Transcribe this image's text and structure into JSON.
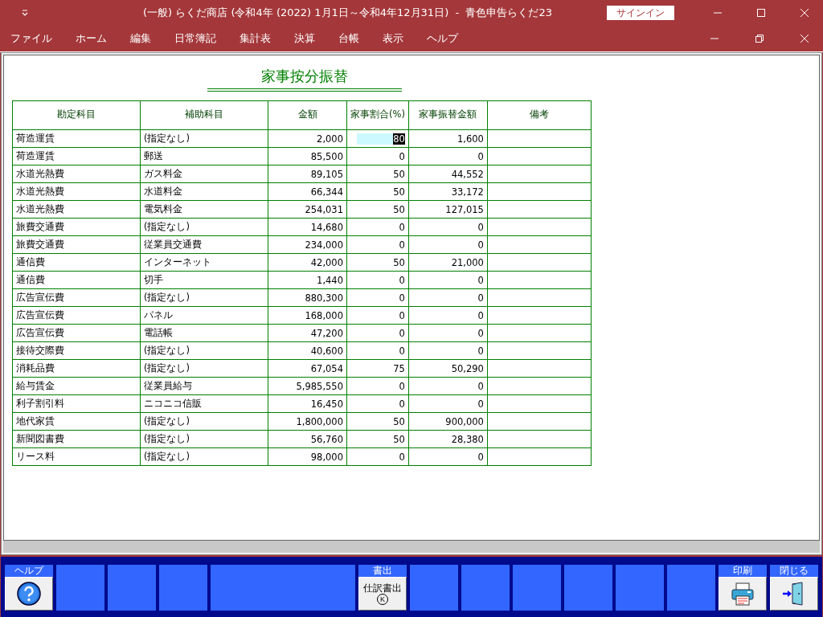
{
  "window": {
    "title": "(一般) らくだ商店 (令和4年 (2022) 1月1日～令和4年12月31日)  -  青色申告らくだ23",
    "sign_in": "サインイン"
  },
  "menu": [
    "ファイル",
    "ホーム",
    "編集",
    "日常簿記",
    "集計表",
    "決算",
    "台帳",
    "表示",
    "ヘルプ"
  ],
  "report": {
    "title": "家事按分振替",
    "columns": [
      "勘定科目",
      "補助科目",
      "金額",
      "家事割合(%)",
      "家事振替金額",
      "備考"
    ],
    "rows": [
      {
        "account": "荷造運賃",
        "sub_account": "(指定なし)",
        "amount": "2,000",
        "ratio": "80",
        "transfer": "1,600",
        "selected": true
      },
      {
        "account": "荷造運賃",
        "sub_account": "郵送",
        "amount": "85,500",
        "ratio": "0",
        "transfer": "0",
        "selected": false
      },
      {
        "account": "水道光熱費",
        "sub_account": "ガス料金",
        "amount": "89,105",
        "ratio": "50",
        "transfer": "44,552",
        "selected": false
      },
      {
        "account": "水道光熱費",
        "sub_account": "水道料金",
        "amount": "66,344",
        "ratio": "50",
        "transfer": "33,172",
        "selected": false
      },
      {
        "account": "水道光熱費",
        "sub_account": "電気料金",
        "amount": "254,031",
        "ratio": "50",
        "transfer": "127,015",
        "selected": false
      },
      {
        "account": "旅費交通費",
        "sub_account": "(指定なし)",
        "amount": "14,680",
        "ratio": "0",
        "transfer": "0",
        "selected": false
      },
      {
        "account": "旅費交通費",
        "sub_account": "従業員交通費",
        "amount": "234,000",
        "ratio": "0",
        "transfer": "0",
        "selected": false
      },
      {
        "account": "通信費",
        "sub_account": "インターネット",
        "amount": "42,000",
        "ratio": "50",
        "transfer": "21,000",
        "selected": false
      },
      {
        "account": "通信費",
        "sub_account": "切手",
        "amount": "1,440",
        "ratio": "0",
        "transfer": "0",
        "selected": false
      },
      {
        "account": "広告宣伝費",
        "sub_account": "(指定なし)",
        "amount": "880,300",
        "ratio": "0",
        "transfer": "0",
        "selected": false
      },
      {
        "account": "広告宣伝費",
        "sub_account": "パネル",
        "amount": "168,000",
        "ratio": "0",
        "transfer": "0",
        "selected": false
      },
      {
        "account": "広告宣伝費",
        "sub_account": "電話帳",
        "amount": "47,200",
        "ratio": "0",
        "transfer": "0",
        "selected": false
      },
      {
        "account": "接待交際費",
        "sub_account": "(指定なし)",
        "amount": "40,600",
        "ratio": "0",
        "transfer": "0",
        "selected": false
      },
      {
        "account": "消耗品費",
        "sub_account": "(指定なし)",
        "amount": "67,054",
        "ratio": "75",
        "transfer": "50,290",
        "selected": false
      },
      {
        "account": "給与賃金",
        "sub_account": "従業員給与",
        "amount": "5,985,550",
        "ratio": "0",
        "transfer": "0",
        "selected": false
      },
      {
        "account": "利子割引料",
        "sub_account": "ニコニコ信販",
        "amount": "16,450",
        "ratio": "0",
        "transfer": "0",
        "selected": false
      },
      {
        "account": "地代家賃",
        "sub_account": "(指定なし)",
        "amount": "1,800,000",
        "ratio": "50",
        "transfer": "900,000",
        "selected": false
      },
      {
        "account": "新聞図書費",
        "sub_account": "(指定なし)",
        "amount": "56,760",
        "ratio": "50",
        "transfer": "28,380",
        "selected": false
      },
      {
        "account": "リース料",
        "sub_account": "(指定なし)",
        "amount": "98,000",
        "ratio": "0",
        "transfer": "0",
        "selected": false
      }
    ]
  },
  "function_keys": [
    {
      "kind": "help",
      "label": "ヘルプ"
    },
    {
      "kind": "blank"
    },
    {
      "kind": "blank"
    },
    {
      "kind": "blank"
    },
    {
      "kind": "wide_blank"
    },
    {
      "kind": "text",
      "label": "書出",
      "button_text": "仕訳書出",
      "shortcut": "K"
    },
    {
      "kind": "blank"
    },
    {
      "kind": "blank"
    },
    {
      "kind": "blank"
    },
    {
      "kind": "blank"
    },
    {
      "kind": "blank"
    },
    {
      "kind": "blank"
    },
    {
      "kind": "print",
      "label": "印刷"
    },
    {
      "kind": "close",
      "label": "閉じる"
    }
  ]
}
